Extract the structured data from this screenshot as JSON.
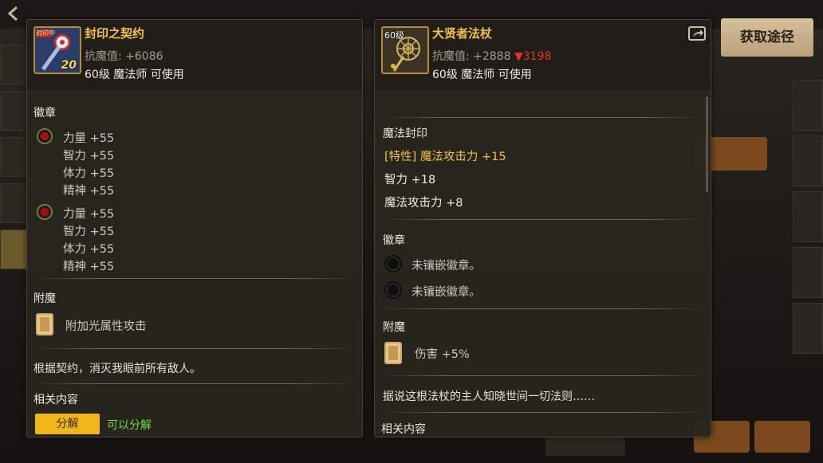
{
  "left_panel": {
    "icon_badge": "20",
    "icon_tag": "封印中",
    "name": "封印之契约",
    "stat_label": "抗魔值:",
    "stat_value": "+6086",
    "requirement": "60级 魔法师 可使用",
    "emblem_title": "徽章",
    "emblems": [
      {
        "lines": [
          "力量 +55",
          "智力 +55",
          "体力 +55",
          "精神 +55"
        ]
      },
      {
        "lines": [
          "力量 +55",
          "智力 +55",
          "体力 +55",
          "精神 +55"
        ]
      }
    ],
    "enchant_title": "附魔",
    "enchant_text": "附加光属性攻击",
    "flavor_text": "根据契约，消灭我眼前所有敌人。",
    "related_title": "相关内容",
    "decompose_button": "分解",
    "decompose_status": "可以分解"
  },
  "right_panel": {
    "level_badge": "60级",
    "name": "大贤者法杖",
    "stat_label": "抗魔值:",
    "stat_value": "+2888",
    "stat_diff": "▼3198",
    "requirement": "60级 魔法师 可使用",
    "seal_title": "魔法封印",
    "seal_lines": [
      "[特性] 魔法攻击力 +15",
      "智力 +18",
      "魔法攻击力 +8"
    ],
    "emblem_title": "徽章",
    "emblem_slots": [
      "未镶嵌徽章。",
      "未镶嵌徽章。"
    ],
    "enchant_title": "附魔",
    "enchant_text": "伤害 +5%",
    "flavor_text": "据说这根法杖的主人知晓世间一切法则……",
    "related_title": "相关内容"
  },
  "get_path_button": "获取途径",
  "colors": {
    "title_gold": "#f3c24a",
    "stat_down_red": "#e0342a",
    "decompose_yellow": "#f0b61a",
    "ok_green": "#6ede3a"
  }
}
